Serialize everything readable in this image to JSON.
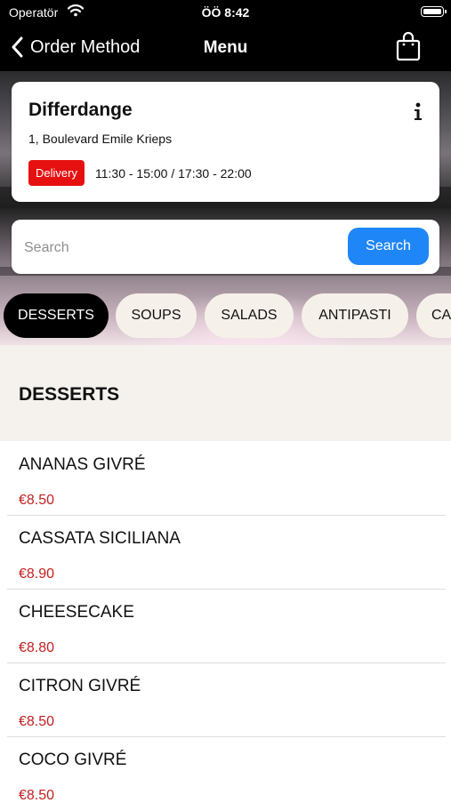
{
  "status_bar": {
    "carrier": "Operatör",
    "time": "ÖÖ 8:42"
  },
  "nav": {
    "back_label": "Order Method",
    "title": "Menu",
    "icons": {
      "back": "chevron-left-icon",
      "cart": "shopping-bag-icon"
    }
  },
  "store": {
    "name": "Differdange",
    "address": "1, Boulevard Emile Krieps",
    "badge": "Delivery",
    "hours": "11:30 - 15:00 / 17:30 - 22:00",
    "info_icon": "info-icon"
  },
  "search": {
    "placeholder": "Search",
    "value": "",
    "button": "Search"
  },
  "categories": [
    {
      "label": "DESSERTS",
      "active": true
    },
    {
      "label": "SOUPS",
      "active": false
    },
    {
      "label": "SALADS",
      "active": false
    },
    {
      "label": "ANTIPASTI",
      "active": false
    },
    {
      "label": "CA",
      "active": false
    }
  ],
  "section": {
    "title": "DESSERTS"
  },
  "items": [
    {
      "name": "ANANAS GIVRÉ",
      "price": "€8.50"
    },
    {
      "name": "CASSATA SICILIANA",
      "price": "€8.90"
    },
    {
      "name": "CHEESECAKE",
      "price": "€8.80"
    },
    {
      "name": "CITRON GIVRÉ",
      "price": "€8.50"
    },
    {
      "name": "COCO GIVRÉ",
      "price": "€8.50"
    }
  ],
  "colors": {
    "accent": "#1f86f7",
    "badge": "#e71010",
    "price": "#c32020",
    "chip_bg": "#f6f0ea",
    "section_bg": "#f5f1ed"
  }
}
